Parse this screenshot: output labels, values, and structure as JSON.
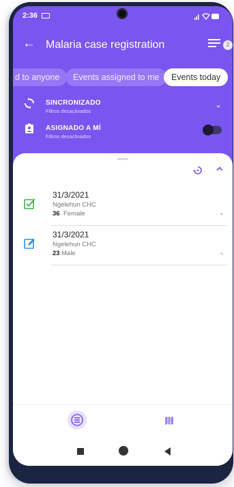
{
  "status_bar": {
    "time": "2:36"
  },
  "app_bar": {
    "title": "Malaria case registration",
    "filter_count": "2"
  },
  "chips": [
    {
      "label": "d to anyone"
    },
    {
      "label": "Events assigned to me"
    },
    {
      "label": "Events today"
    }
  ],
  "sync_row": {
    "label": "SINCRONIZADO",
    "sub": "Filtros desactivados"
  },
  "assigned_row": {
    "label": "ASIGNADO A MÍ",
    "sub": "Filtros desactivados"
  },
  "events": [
    {
      "date": "31/3/2021",
      "org_unit": "Ngelehun CHC",
      "age": "36",
      "gender": "Female",
      "status_icon": "event-completed-icon"
    },
    {
      "date": "31/3/2021",
      "org_unit": "Ngelehun CHC",
      "age": "23",
      "gender": "Male",
      "status_icon": "event-edit-icon"
    }
  ],
  "colors": {
    "primary": "#7a55f0",
    "completed": "#3fae49",
    "edit": "#2f8de4",
    "chip_bg": "#9677f6"
  },
  "icons": {
    "back": "back-arrow-icon",
    "filter": "filter-list-icon",
    "sync": "sync-icon",
    "assigned": "assignment-ind-icon",
    "restore": "restore-icon",
    "collapse": "chevron-up-icon",
    "list_tab": "list-icon",
    "map_tab": "map-icon"
  }
}
